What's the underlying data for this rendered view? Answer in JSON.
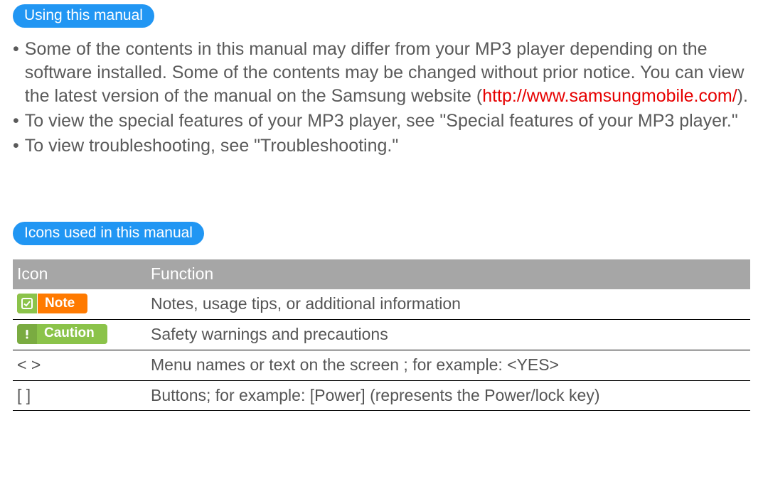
{
  "sections": {
    "using": {
      "title": "Using this manual",
      "bullets": [
        {
          "text_pre": "Some of the contents in this manual may differ from your MP3 player depending on the software installed. Some of the contents may be changed without prior notice. You can view the latest version of the manual on the Samsung website (",
          "url": "http://www.samsungmobile.com/",
          "text_post": ")."
        },
        {
          "text_pre": "To view the special features of your MP3 player, see \"Special features of your MP3 player.\"",
          "url": "",
          "text_post": ""
        },
        {
          "text_pre": "To view troubleshooting, see \"Troubleshooting.\"",
          "url": "",
          "text_post": ""
        }
      ]
    },
    "icons": {
      "title": "Icons used in this manual",
      "headers": {
        "icon": "Icon",
        "function": "Function"
      },
      "rows": [
        {
          "icon_label": "Note",
          "icon_type": "note",
          "function": "Notes, usage tips, or additional information"
        },
        {
          "icon_label": "Caution",
          "icon_type": "caution",
          "function": "Safety warnings and precautions"
        },
        {
          "icon_label": "<   >",
          "icon_type": "text",
          "function": "Menu names or text on the screen ; for example: <YES>"
        },
        {
          "icon_label": "[    ]",
          "icon_type": "text",
          "function": "Buttons; for example: [Power] (represents the Power/lock key)"
        }
      ]
    }
  },
  "bullet_char": "•"
}
